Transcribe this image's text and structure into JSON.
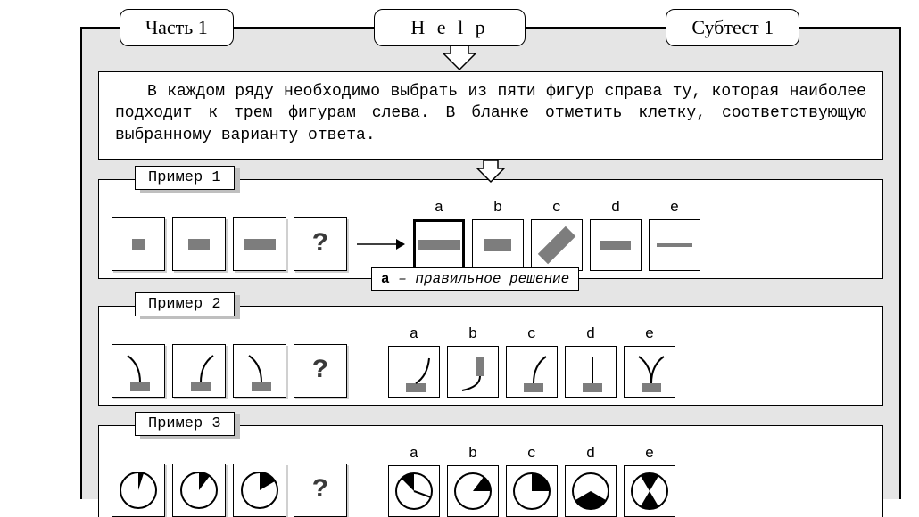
{
  "tabs": {
    "part": "Часть  1",
    "help": "H e l p",
    "subtest": "Субтест  1"
  },
  "instruction": "В каждом ряду необходимо выбрать из пяти фигур справа ту, которая наиболее подходит к трем фигурам слева. В бланке отметить клетку, соответствующую выбранному варианту ответа.",
  "labels": {
    "example1": "Пример  1",
    "example2": "Пример  2",
    "example3": "Пример  3",
    "question": "?",
    "options": [
      "a",
      "b",
      "c",
      "d",
      "e"
    ],
    "answer_prefix": "a",
    "answer_text": " – правильное  решение"
  }
}
